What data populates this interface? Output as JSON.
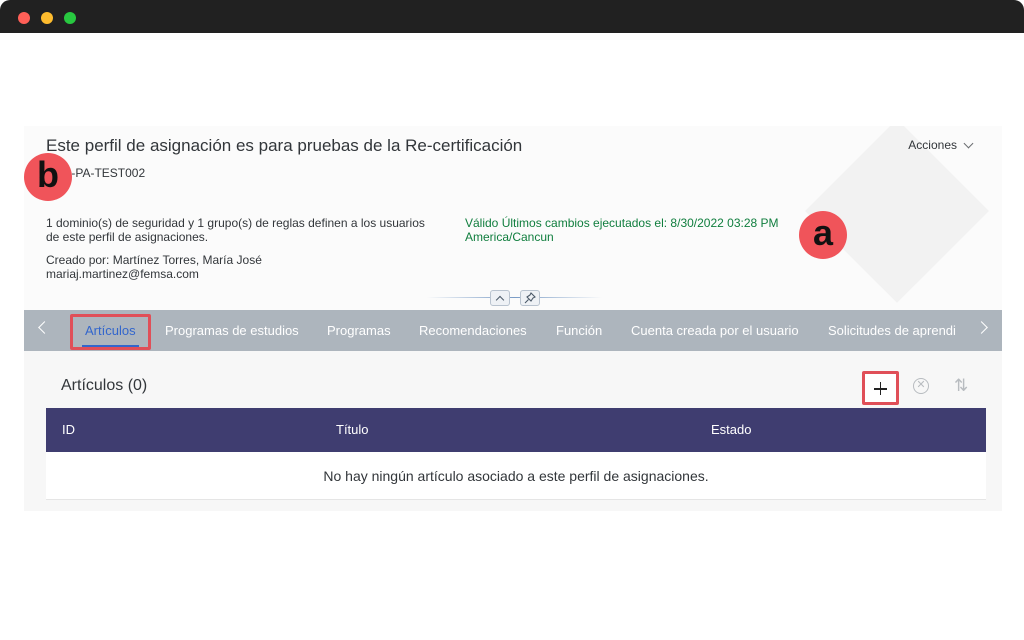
{
  "window": {
    "controls": {
      "close_color": "#ff5f57",
      "minimize_color": "#febc2e",
      "maximize_color": "#28c840"
    }
  },
  "header": {
    "title": "Este perfil de asignación es para pruebas de la Re-certificación",
    "id": "FEM-PA-TEST002",
    "actions_label": "Acciones",
    "description": "1 dominio(s) de seguridad y 1 grupo(s) de reglas definen a los usuarios de este perfil de asignaciones.",
    "created_by_line1": "Creado por: Martínez Torres, María José",
    "created_by_line2": "mariaj.martinez@femsa.com",
    "status_line1": "Válido Últimos cambios ejecutados el: 8/30/2022 03:28 PM",
    "status_line2": "America/Cancun"
  },
  "tabs": [
    {
      "label": "Artículos",
      "active": true
    },
    {
      "label": "Programas de estudios"
    },
    {
      "label": "Programas"
    },
    {
      "label": "Recomendaciones"
    },
    {
      "label": "Función"
    },
    {
      "label": "Cuenta creada por el usuario"
    },
    {
      "label": "Solicitudes de aprendi"
    }
  ],
  "section": {
    "title": "Artículos (0)",
    "columns": [
      "ID",
      "Título",
      "Estado"
    ],
    "empty_message": "No hay ningún artículo asociado a este perfil de asignaciones."
  },
  "annotations": {
    "a": "a",
    "b": "b",
    "highlight_color": "#e04f58"
  },
  "colors": {
    "table_header": "#3f3d70",
    "tabbar": "#adb5bd",
    "active_tab": "#3366cc",
    "status_green": "#107e3e"
  }
}
